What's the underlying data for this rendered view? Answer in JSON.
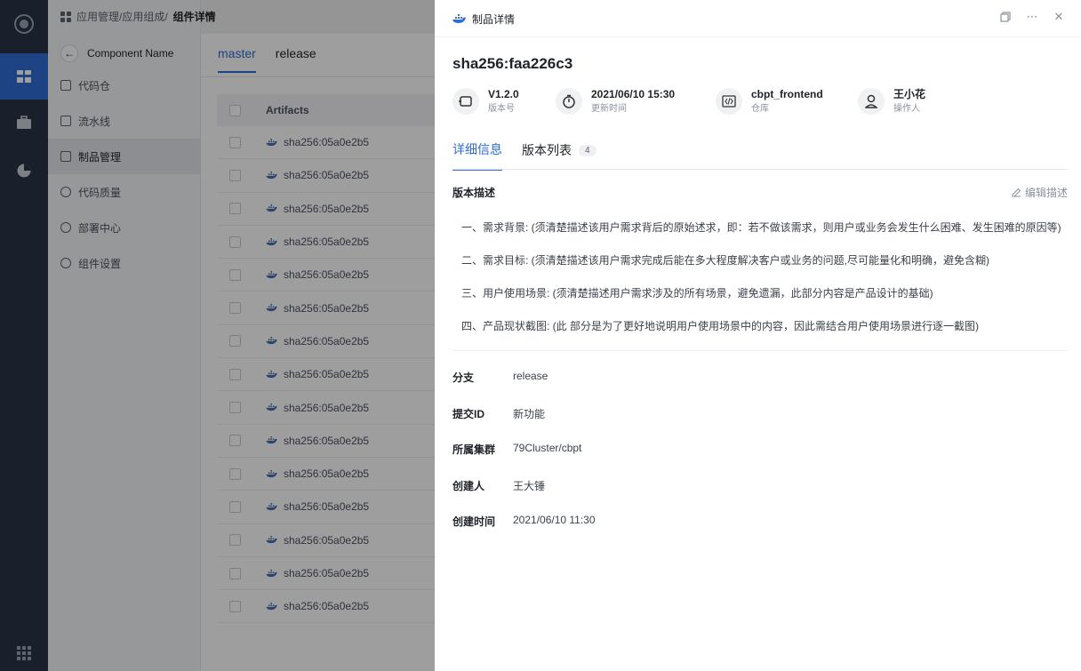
{
  "breadcrumb": {
    "path": "应用管理/应用组成/",
    "current": "组件详情"
  },
  "component_header": {
    "name": "Component Name"
  },
  "nav": {
    "items": [
      {
        "label": "代码仓",
        "icon": "code-repo-icon"
      },
      {
        "label": "流水线",
        "icon": "pipeline-icon"
      },
      {
        "label": "制品管理",
        "icon": "artifact-icon",
        "active": true
      },
      {
        "label": "代码质量",
        "icon": "quality-icon"
      },
      {
        "label": "部署中心",
        "icon": "deploy-icon"
      },
      {
        "label": "组件设置",
        "icon": "settings-icon"
      }
    ]
  },
  "branch_tabs": [
    {
      "label": "master",
      "active": true
    },
    {
      "label": "release",
      "active": false
    }
  ],
  "table": {
    "header": "Artifacts",
    "rows": [
      "sha256:05a0e2b5",
      "sha256:05a0e2b5",
      "sha256:05a0e2b5",
      "sha256:05a0e2b5",
      "sha256:05a0e2b5",
      "sha256:05a0e2b5",
      "sha256:05a0e2b5",
      "sha256:05a0e2b5",
      "sha256:05a0e2b5",
      "sha256:05a0e2b5",
      "sha256:05a0e2b5",
      "sha256:05a0e2b5",
      "sha256:05a0e2b5",
      "sha256:05a0e2b5",
      "sha256:05a0e2b5"
    ]
  },
  "drawer": {
    "header_title": "制品详情",
    "title": "sha256:faa226c3",
    "meta": [
      {
        "value": "V1.2.0",
        "label": "版本号",
        "icon": "version-icon"
      },
      {
        "value": "2021/06/10 15:30",
        "label": "更新时间",
        "icon": "timer-icon"
      },
      {
        "value": "cbpt_frontend",
        "label": "仓库",
        "icon": "code-icon"
      },
      {
        "value": "王小花",
        "label": "操作人",
        "icon": "user-icon"
      }
    ],
    "tabs": [
      {
        "label": "详细信息",
        "active": true
      },
      {
        "label": "版本列表",
        "count": "4",
        "active": false
      }
    ],
    "section_title": "版本描述",
    "edit_label": "编辑描述",
    "description": [
      "一、需求背景: (须清楚描述该用户需求背后的原始述求，即：若不做该需求，则用户或业务会发生什么困难、发生困难的原因等)",
      "二、需求目标: (须清楚描述该用户需求完成后能在多大程度解决客户或业务的问题,尽可能量化和明确，避免含糊)",
      "三、用户使用场景: (须清楚描述用户需求涉及的所有场景，避免遗漏，此部分内容是产品设计的基础)",
      "四、产品现状截图: (此 部分是为了更好地说明用户使用场景中的内容，因此需结合用户使用场景进行逐一截图)"
    ],
    "fields": [
      {
        "label": "分支",
        "value": "release"
      },
      {
        "label": "提交ID",
        "value": "新功能"
      },
      {
        "label": "所属集群",
        "value": "79Cluster/cbpt"
      },
      {
        "label": "创建人",
        "value": "王大锤"
      },
      {
        "label": "创建时间",
        "value": "2021/06/10 11:30"
      }
    ]
  },
  "colors": {
    "accent": "#2f6cd6",
    "rail": "#2b3446"
  }
}
